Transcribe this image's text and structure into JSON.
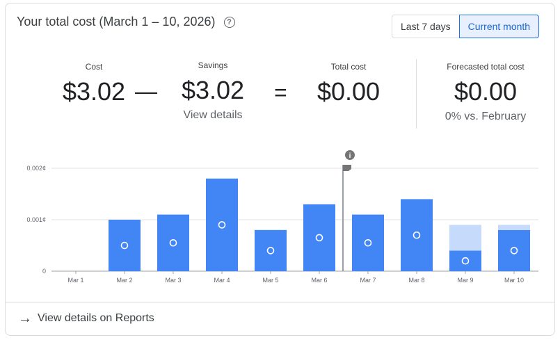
{
  "header": {
    "title": "Your total cost (March 1 – 10, 2026)",
    "help_icon": "help-circle-icon",
    "range_options": [
      "Last 7 days",
      "Current month"
    ],
    "range_selected": "Current month"
  },
  "summary": {
    "cost_label": "Cost",
    "cost_value": "$3.02",
    "minus_symbol": "—",
    "savings_label": "Savings",
    "savings_value": "$3.02",
    "savings_link": "View details",
    "equals_symbol": "=",
    "total_label": "Total cost",
    "total_value": "$0.00",
    "forecast_label": "Forecasted total cost",
    "forecast_value": "$0.00",
    "forecast_comparison": "0% vs. February"
  },
  "chart_data": {
    "type": "bar",
    "categories": [
      "Mar 1",
      "Mar 2",
      "Mar 3",
      "Mar 4",
      "Mar 5",
      "Mar 6",
      "Mar 7",
      "Mar 8",
      "Mar 9",
      "Mar 10"
    ],
    "series": [
      {
        "values": [
          0,
          0.001,
          0.0011,
          0.0018,
          0.0008,
          0.0013,
          0.0011,
          0.0014,
          0.0004,
          0.0008
        ]
      },
      {
        "values": [
          0,
          0,
          0,
          0,
          0,
          0,
          0,
          0,
          0.0005,
          0.0001
        ]
      }
    ],
    "line_markers": [
      0,
      0.0005,
      0.00055,
      0.0009,
      0.0004,
      0.00065,
      0.00055,
      0.0007,
      0.0002,
      0.0004
    ],
    "ytick_labels": [
      "0",
      "0.001¢",
      "0.002¢"
    ],
    "ylim": [
      0,
      0.002
    ],
    "grid": true,
    "annotation_after": "Mar 6",
    "annotation_icon": "info-icon",
    "colors": {
      "primary": "#4285f4",
      "secondary": "#c6dafc",
      "marker": "#ffffff"
    }
  },
  "footer": {
    "link_label": "View details on Reports",
    "icon": "arrow-right-icon"
  }
}
